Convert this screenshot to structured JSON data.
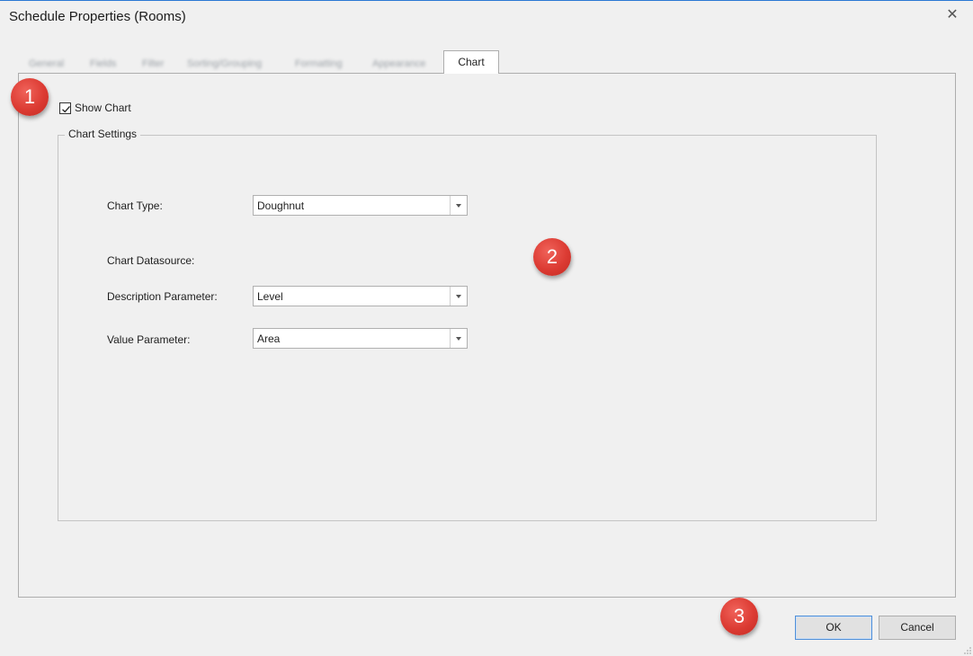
{
  "window": {
    "title": "Schedule Properties (Rooms)",
    "close_glyph": "✕"
  },
  "tabs": {
    "inactive": [
      "General",
      "Fields",
      "Filter",
      "Sorting/Grouping",
      "Formatting",
      "Appearance"
    ],
    "active": "Chart"
  },
  "show_chart": {
    "label": "Show Chart",
    "checked": true
  },
  "chart_settings": {
    "legend": "Chart Settings",
    "chart_type_label": "Chart Type:",
    "chart_type_value": "Doughnut",
    "datasource_label": "Chart Datasource:",
    "description_label": "Description Parameter:",
    "description_value": "Level",
    "value_label": "Value Parameter:",
    "value_value": "Area"
  },
  "buttons": {
    "ok": "OK",
    "cancel": "Cancel"
  },
  "markers": [
    "1",
    "2",
    "3"
  ],
  "colors": {
    "marker_red": "#dc3b33",
    "accent_blue": "#2b79d3"
  }
}
